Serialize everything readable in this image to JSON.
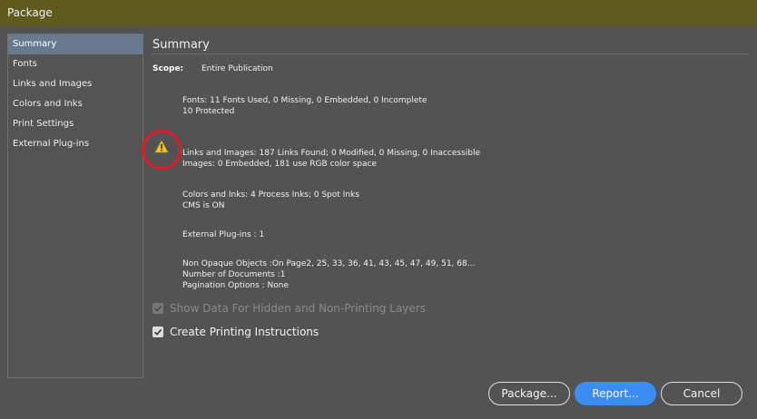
{
  "window": {
    "title": "Package"
  },
  "sidebar": {
    "items": [
      {
        "label": "Summary"
      },
      {
        "label": "Fonts"
      },
      {
        "label": "Links and Images"
      },
      {
        "label": "Colors and Inks"
      },
      {
        "label": "Print Settings"
      },
      {
        "label": "External Plug-ins"
      }
    ]
  },
  "summary": {
    "title": "Summary",
    "scope_label": "Scope:",
    "scope_value": "Entire Publication",
    "fonts": {
      "line1": "Fonts: 11 Fonts Used, 0 Missing, 0 Embedded, 0 Incomplete",
      "line2": "10 Protected"
    },
    "links": {
      "line1": "Links and Images: 187 Links Found; 0 Modified, 0 Missing, 0 Inaccessible",
      "line2": "Images: 0 Embedded, 181 use RGB color space"
    },
    "colors": {
      "line1": "Colors and Inks: 4 Process Inks; 0 Spot Inks",
      "line2": "CMS is ON"
    },
    "plugins": {
      "line1": "External Plug-ins : 1"
    },
    "misc": {
      "line1": "Non Opaque Objects :On Page2, 25, 33, 36, 41, 43, 45, 47, 49, 51, 68...",
      "line2": "Number of Documents :1",
      "line3": "Pagination Options : None"
    }
  },
  "options": {
    "show_hidden": {
      "label": "Show Data For Hidden and Non-Printing Layers",
      "checked": true,
      "disabled": true
    },
    "printing_instructions": {
      "label": "Create Printing Instructions",
      "checked": true,
      "disabled": false
    }
  },
  "buttons": {
    "package": "Package...",
    "report": "Report...",
    "cancel": "Cancel"
  },
  "icons": {
    "warning": "warning-triangle-icon",
    "annotation": "red-circle-annotation",
    "check": "checkmark-icon"
  },
  "colors": {
    "titlebar": "#5e5b1d",
    "accent": "#3b8df3",
    "selected": "#6a7a8e",
    "annotation": "#d81e2a",
    "warning": "#f2c21b"
  }
}
